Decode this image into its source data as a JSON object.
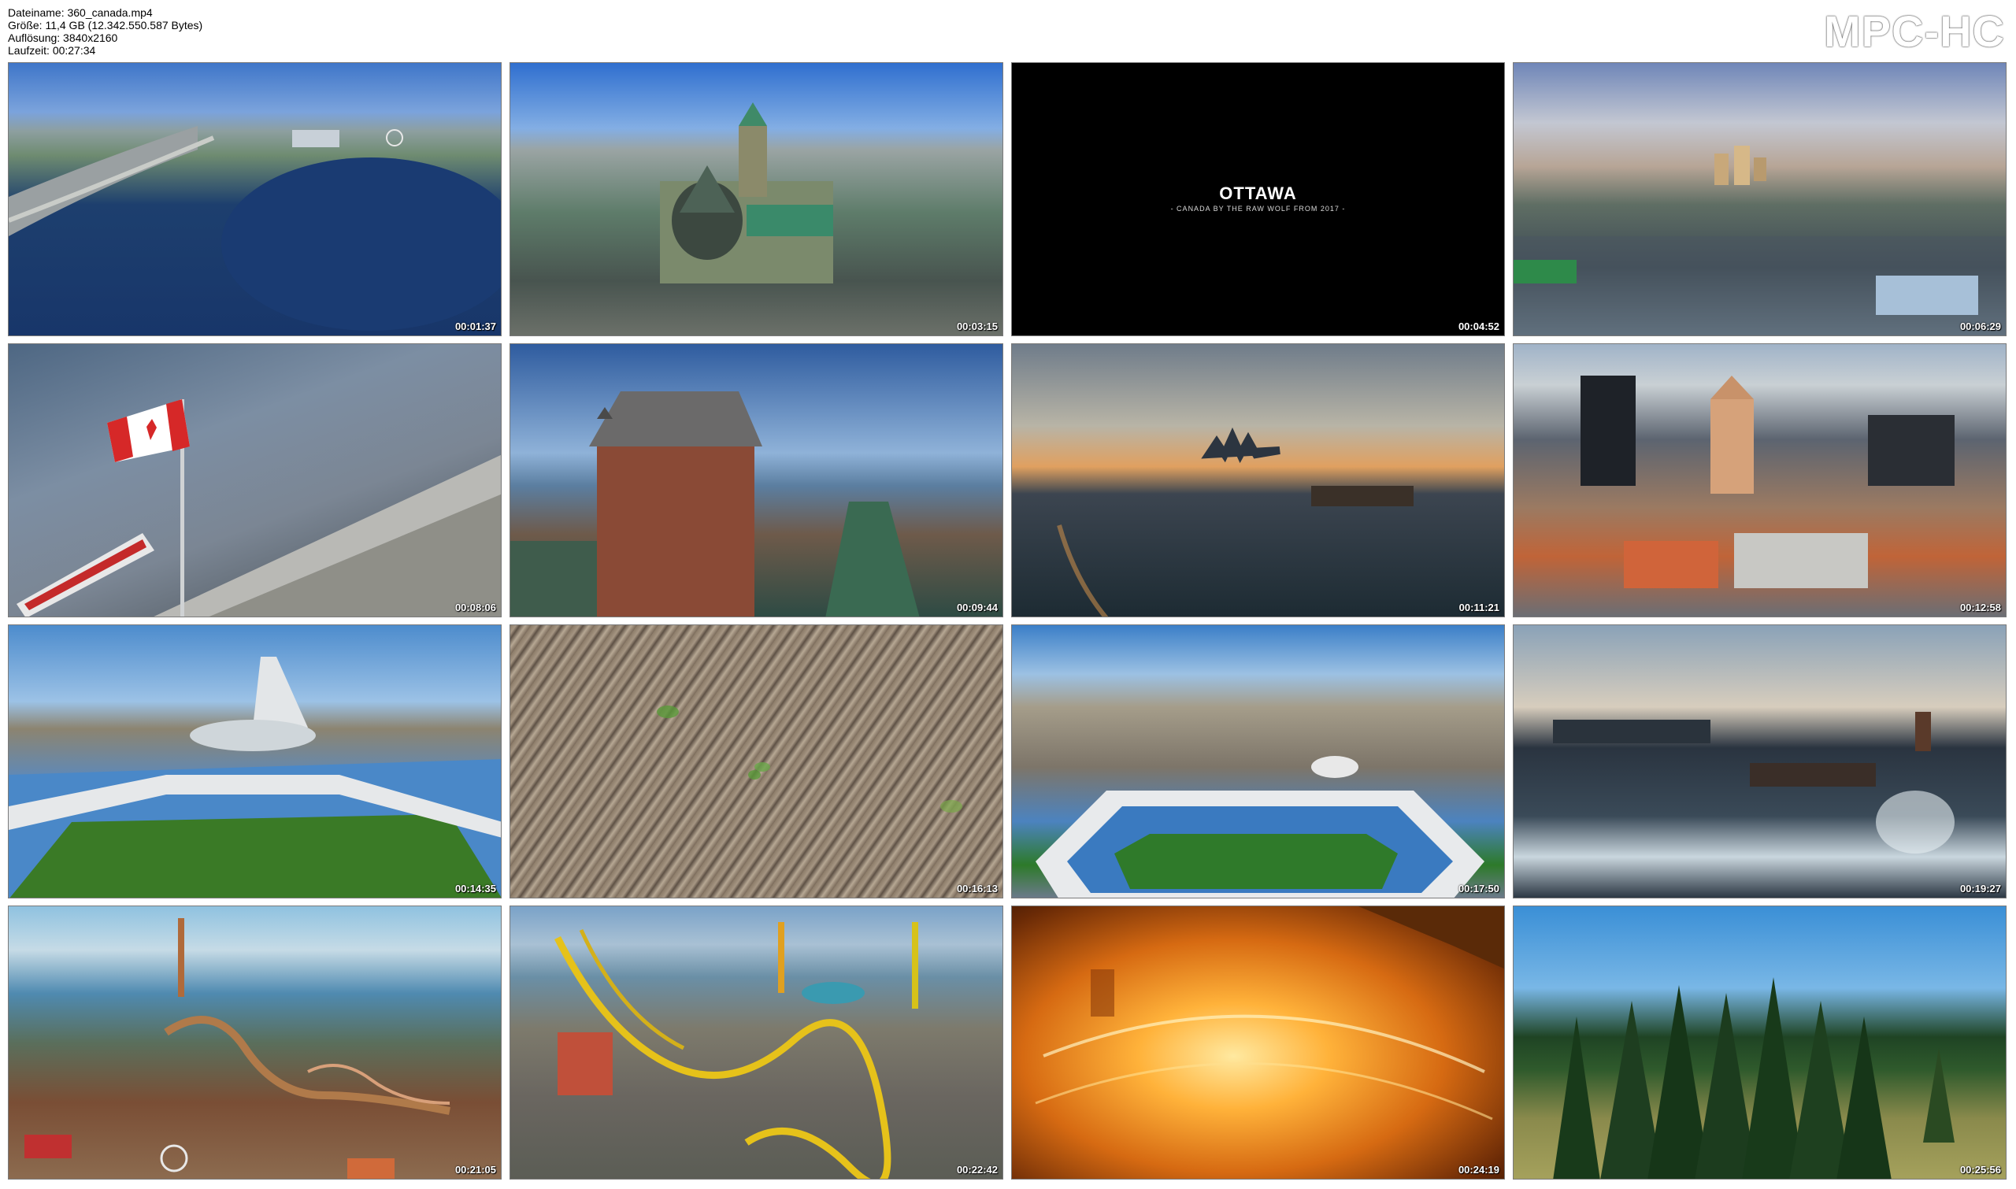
{
  "info": {
    "filename": "Dateiname: 360_canada.mp4",
    "size": "Größe: 11,4 GB (12.342.550.587 Bytes)",
    "resolution": "Auflösung: 3840x2160",
    "duration": "Laufzeit: 00:27:34"
  },
  "logo": "MPC-HC",
  "title_card": {
    "title": "OTTAWA",
    "subtitle": "- CANADA BY THE RAW WOLF FROM 2017 -"
  },
  "thumbnails": [
    {
      "timestamp": "00:01:37"
    },
    {
      "timestamp": "00:03:15"
    },
    {
      "timestamp": "00:04:52"
    },
    {
      "timestamp": "00:06:29"
    },
    {
      "timestamp": "00:08:06"
    },
    {
      "timestamp": "00:09:44"
    },
    {
      "timestamp": "00:11:21"
    },
    {
      "timestamp": "00:12:58"
    },
    {
      "timestamp": "00:14:35"
    },
    {
      "timestamp": "00:16:13"
    },
    {
      "timestamp": "00:17:50"
    },
    {
      "timestamp": "00:19:27"
    },
    {
      "timestamp": "00:21:05"
    },
    {
      "timestamp": "00:22:42"
    },
    {
      "timestamp": "00:24:19"
    },
    {
      "timestamp": "00:25:56"
    }
  ]
}
